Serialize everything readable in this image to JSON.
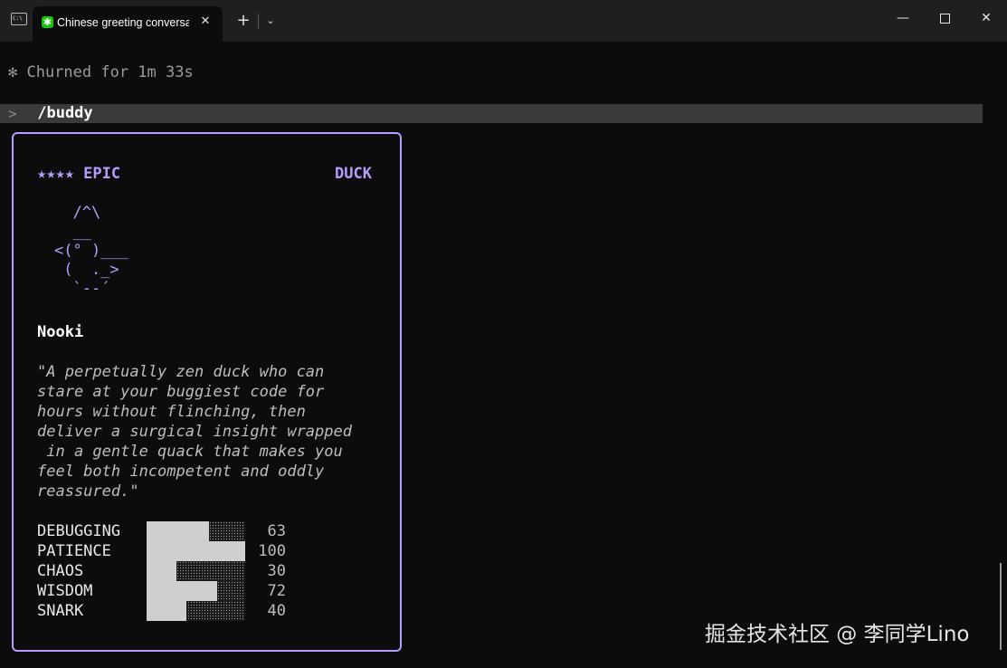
{
  "window": {
    "tab_title": "Chinese greeting conversation",
    "tab_close": "✕",
    "new_tab": "+",
    "dropdown": "⌄",
    "minimize": "—",
    "close": "✕"
  },
  "icons": {
    "app": "terminal-icon",
    "tab": "claude-spark-icon"
  },
  "terminal": {
    "churn_text": "✻ Churned for 1m 33s",
    "prompt_symbol": ">",
    "command": " /buddy"
  },
  "buddy": {
    "rarity": "★★★★ EPIC",
    "species": "DUCK",
    "art": "  /^\\\n  __\n<(° )___\n (  ._>\n  `--´",
    "name": "Nooki",
    "description": "\"A perpetually zen duck who can\nstare at your buggiest code for\nhours without flinching, then\ndeliver a surgical insight wrapped\n in a gentle quack that makes you\nfeel both incompetent and oddly\nreassured.\"",
    "stats": [
      {
        "label": "DEBUGGING",
        "value": 63
      },
      {
        "label": "PATIENCE",
        "value": 100
      },
      {
        "label": "CHAOS",
        "value": 30
      },
      {
        "label": "WISDOM",
        "value": 72
      },
      {
        "label": "SNARK",
        "value": 40
      }
    ]
  },
  "watermark": "掘金技术社区 @ 李同学Lino",
  "colors": {
    "accent": "#b79cff",
    "background": "#0c0c0c",
    "titlebar": "#1f1f1f",
    "prompt_bg": "#3a3a3a"
  }
}
